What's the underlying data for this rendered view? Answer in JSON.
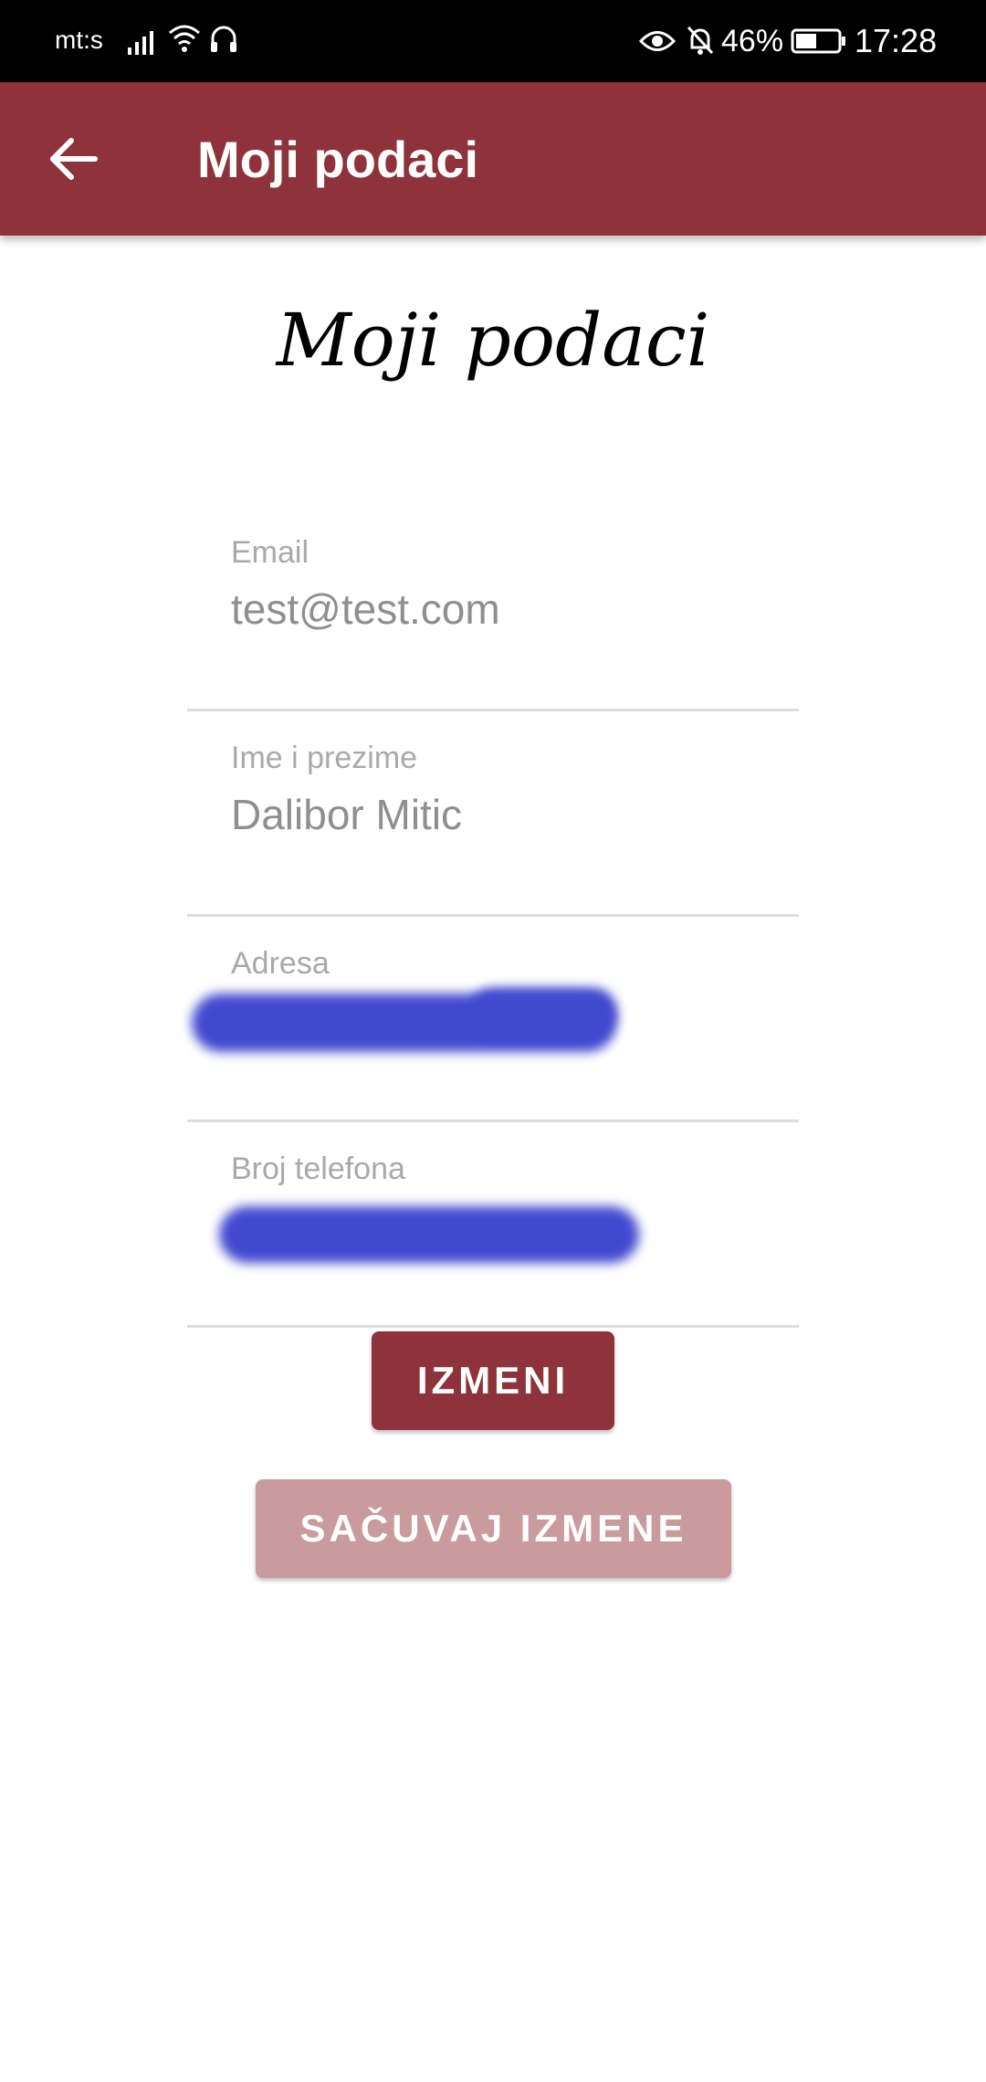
{
  "status_bar": {
    "carrier": "mt:s",
    "battery_percent": "46%",
    "time": "17:28",
    "icons": [
      "signal-icon",
      "wifi-icon",
      "headphones-icon",
      "eye-icon",
      "bell-off-icon",
      "battery-icon"
    ]
  },
  "app_bar": {
    "title": "Moji podaci",
    "back_icon": "arrow-left-icon",
    "color": "#8e333b"
  },
  "heading": "Moji podaci",
  "form": {
    "email": {
      "label": "Email",
      "value": "test@test.com"
    },
    "name": {
      "label": "Ime i prezime",
      "value": "Dalibor Mitic"
    },
    "address": {
      "label": "Adresa"
    },
    "phone": {
      "label": "Broj telefona"
    }
  },
  "buttons": {
    "edit": "IZMENI",
    "save": "SAČUVAJ IZMENE"
  }
}
